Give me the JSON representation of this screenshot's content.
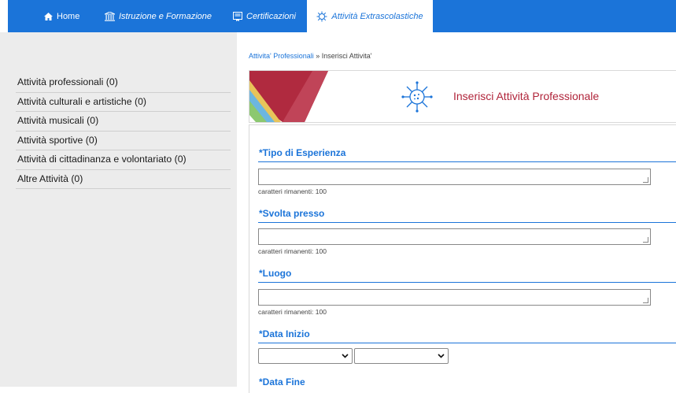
{
  "nav": {
    "items": [
      {
        "label": "Home",
        "icon": "home-icon"
      },
      {
        "label": "Istruzione e Formazione",
        "icon": "building-icon"
      },
      {
        "label": "Certificazioni",
        "icon": "certificate-icon"
      },
      {
        "label": "Attività Extrascolastiche",
        "icon": "virus-icon"
      }
    ],
    "active": "Attività Extrascolastiche"
  },
  "sidebar": {
    "items": [
      {
        "label": "Attività professionali (0)"
      },
      {
        "label": "Attività culturali e artistiche (0)"
      },
      {
        "label": "Attività musicali (0)"
      },
      {
        "label": "Attività sportive (0)"
      },
      {
        "label": "Attività di cittadinanza e volontariato (0)"
      },
      {
        "label": "Altre Attività (0)"
      }
    ]
  },
  "breadcrumb": {
    "link": "Attivita' Professionali",
    "separator": " » ",
    "current": "Inserisci Attivita'"
  },
  "header": {
    "title": "Inserisci Attività Professionale",
    "icon": "virus-icon"
  },
  "form": {
    "fields": [
      {
        "label": "*Tipo di Esperienza",
        "value": "",
        "hint": "caratteri rimanenti: 100"
      },
      {
        "label": "*Svolta presso",
        "value": "",
        "hint": "caratteri rimanenti: 100"
      },
      {
        "label": "*Luogo",
        "value": "",
        "hint": "caratteri rimanenti: 100"
      }
    ],
    "data_inizio": {
      "label": "*Data Inizio",
      "month": "",
      "year": ""
    },
    "data_fine": {
      "label": "*Data Fine"
    }
  },
  "colors": {
    "accent": "#1b74d9",
    "title": "#b0243a",
    "sidebar_bg": "#ececec"
  }
}
